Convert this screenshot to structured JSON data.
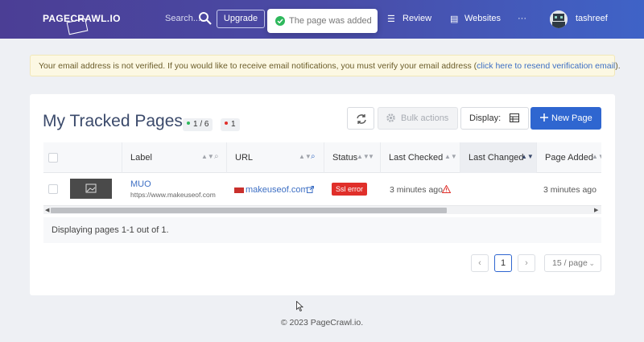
{
  "header": {
    "logo": "PAGECRAWL.IO",
    "search_placeholder": "Search...",
    "upgrade_label": "Upgrade",
    "toast_text": "The page was added",
    "nav": [
      {
        "label": "Review",
        "icon": "list-icon"
      },
      {
        "label": "Websites",
        "icon": "grid-icon"
      },
      {
        "label": "···",
        "icon": "more-icon"
      }
    ],
    "username": "tashreef"
  },
  "notice": {
    "text": "Your email address is not verified. If you would like to receive email notifications, you must verify your email address (",
    "link": "click here to resend verification email",
    "suffix": ")."
  },
  "main": {
    "title": "My Tracked Pages",
    "badge_pages": "1 / 6",
    "badge_errors": "1",
    "bulk_label": "Bulk actions",
    "display_label": "Display:",
    "new_page_label": "New Page",
    "columns": [
      "Label",
      "URL",
      "Status",
      "Last Checked",
      "Last Changed",
      "Page Added"
    ],
    "rows": [
      {
        "label": "MUO",
        "label_url": "https://www.makeuseof.com",
        "url": "makeuseof.com",
        "status": "Ssl error",
        "last_checked": "3 minutes ago",
        "last_changed": "",
        "page_added": "3 minutes ago"
      }
    ],
    "summary": "Displaying pages 1-1 out of 1.",
    "pagination": {
      "prev": "‹",
      "current": "1",
      "next": "›",
      "per_page": "15 / page"
    }
  },
  "footer": {
    "copyright": "© 2023 PageCrawl.io."
  },
  "colors": {
    "primary": "#2f66d0",
    "header_start": "#4b3e95",
    "header_end": "#3f63c7",
    "error": "#e02f2a",
    "success_dot": "#2eb85c"
  }
}
